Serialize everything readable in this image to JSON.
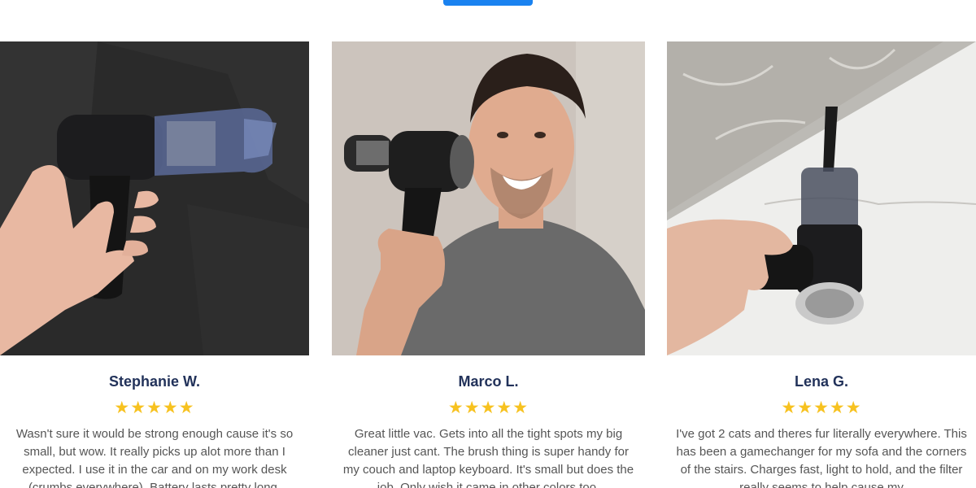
{
  "reviews": [
    {
      "name": "Stephanie W.",
      "rating": 5,
      "text": "Wasn't sure it would be strong enough cause it's so small, but wow. It really picks up alot more than I expected. I use it in the car and on my work desk (crumbs everywhere). Battery lasts pretty long."
    },
    {
      "name": "Marco L.",
      "rating": 5,
      "text": "Great little vac. Gets into all the tight spots my big cleaner just cant. The brush thing is super handy for my couch and laptop keyboard. It's small but does the job. Only wish it came in other colors too."
    },
    {
      "name": "Lena G.",
      "rating": 5,
      "text": "I've got 2 cats and theres fur literally everywhere. This has been a gamechanger for my sofa and the corners of the stairs. Charges fast, light to hold, and the filter really seems to help cause my"
    }
  ],
  "colors": {
    "accent": "#1a82f0",
    "name": "#22325a",
    "star": "#f7c220",
    "body_text": "#555555"
  },
  "icons": {
    "star": "star-icon"
  }
}
